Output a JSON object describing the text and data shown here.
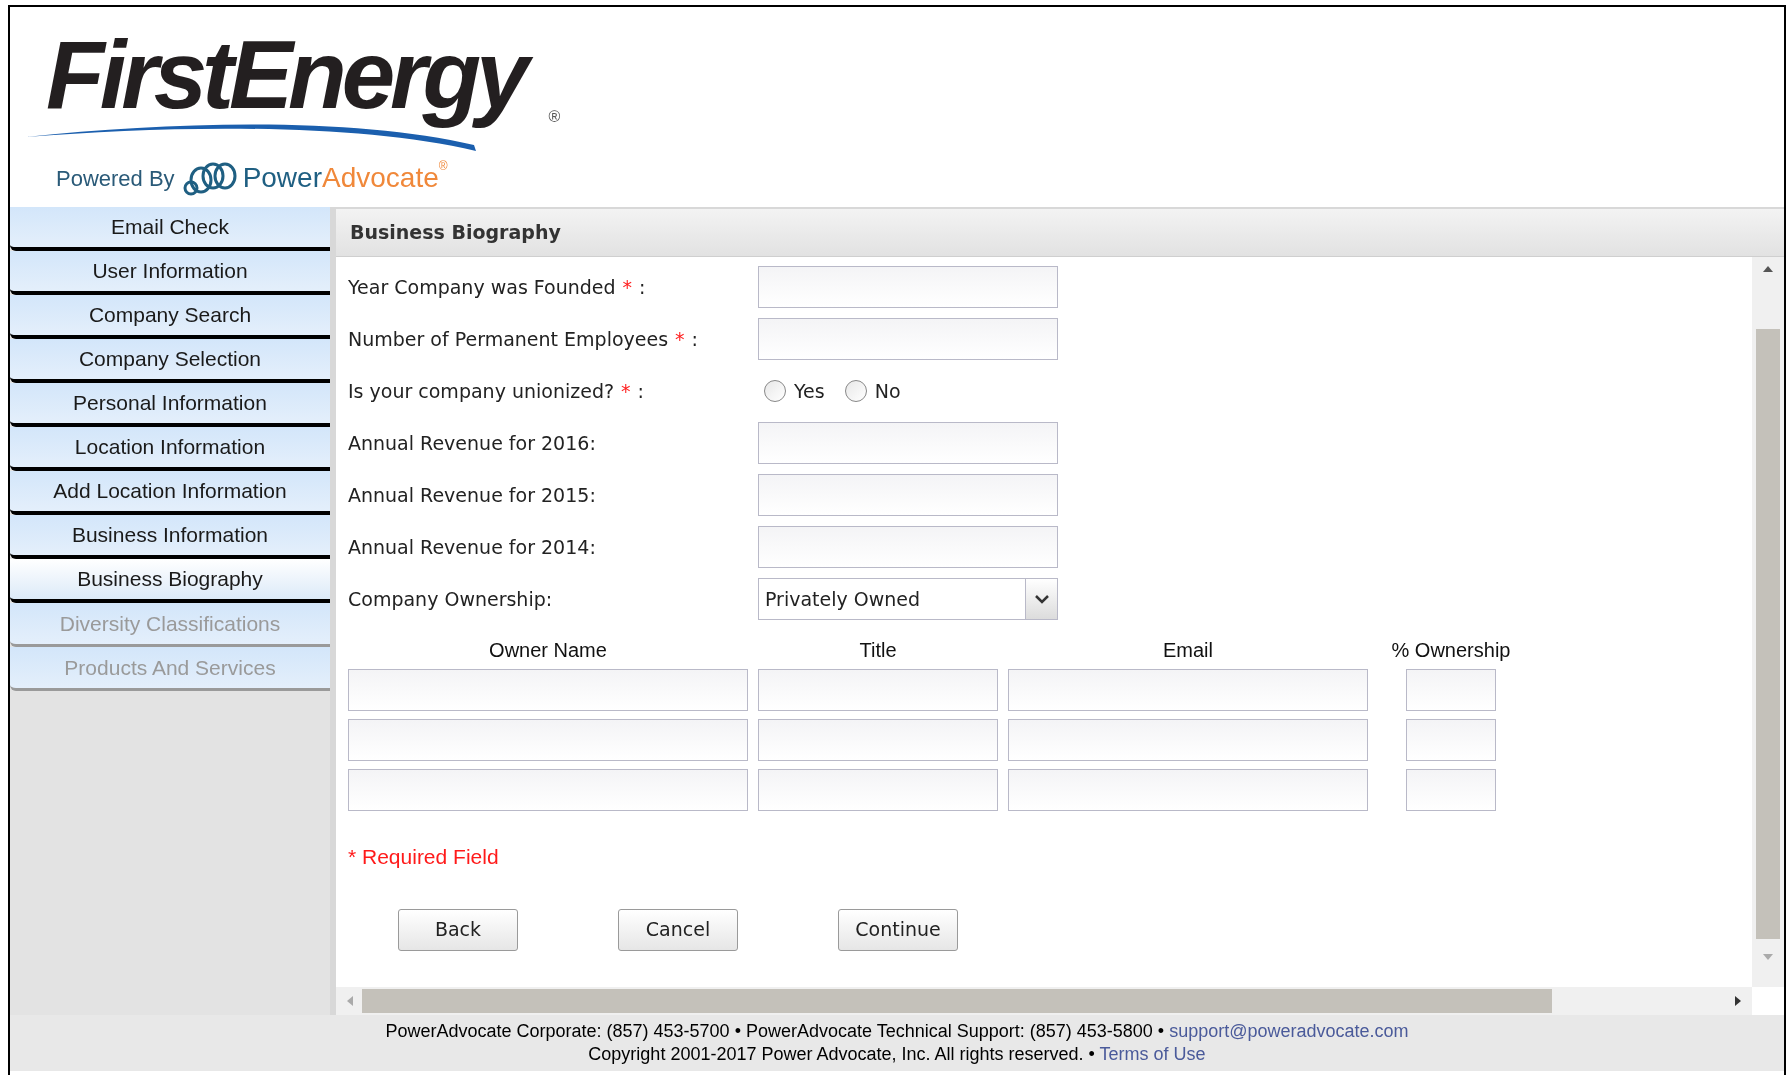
{
  "logo": {
    "name": "FirstEnergy",
    "registered": "®",
    "powered_by": "Powered By",
    "brand_first": "Power",
    "brand_second": "Advocate",
    "brand_registered": "®"
  },
  "sidebar": {
    "items": [
      {
        "label": "Email Check",
        "selected": false,
        "disabled": false
      },
      {
        "label": "User Information",
        "selected": false,
        "disabled": false
      },
      {
        "label": "Company Search",
        "selected": false,
        "disabled": false
      },
      {
        "label": "Company Selection",
        "selected": false,
        "disabled": false
      },
      {
        "label": "Personal Information",
        "selected": false,
        "disabled": false
      },
      {
        "label": "Location Information",
        "selected": false,
        "disabled": false
      },
      {
        "label": "Add Location Information",
        "selected": false,
        "disabled": false
      },
      {
        "label": "Business Information",
        "selected": false,
        "disabled": false
      },
      {
        "label": "Business Biography",
        "selected": true,
        "disabled": false
      },
      {
        "label": "Diversity Classifications",
        "selected": false,
        "disabled": true
      },
      {
        "label": "Products And Services",
        "selected": false,
        "disabled": true
      }
    ]
  },
  "panel": {
    "title": "Business Biography",
    "fields": [
      {
        "kind": "text",
        "label": "Year Company was Founded",
        "mark": "*",
        "suffix": ":"
      },
      {
        "kind": "text",
        "label": "Number of Permanent Employees",
        "mark": "*",
        "suffix": ":"
      },
      {
        "kind": "radio",
        "label": "Is your company unionized?",
        "mark": "*",
        "suffix": ":",
        "options": [
          {
            "label": "Yes",
            "checked": false
          },
          {
            "label": "No",
            "checked": false
          }
        ]
      },
      {
        "kind": "text",
        "label": "Annual Revenue for 2016:"
      },
      {
        "kind": "text",
        "label": "Annual Revenue for 2015:"
      },
      {
        "kind": "text",
        "label": "Annual Revenue for 2014:"
      },
      {
        "kind": "select",
        "label": "Company Ownership:",
        "value": "Privately Owned"
      }
    ],
    "owners": {
      "columns": [
        "Owner Name",
        "Title",
        "Email",
        "% Ownership"
      ],
      "rows": [
        {
          "kind": "blank"
        },
        {
          "kind": "blank"
        },
        {
          "kind": "blank"
        }
      ]
    },
    "required_note": "* Required Field",
    "buttons": [
      "Back",
      "Cancel",
      "Continue"
    ]
  },
  "footer": {
    "line_1": "PowerAdvocate Corporate: (857) 453-5700 • PowerAdvocate Technical Support: (857) 453-5800 •",
    "email_link": "support@poweradvocate.com",
    "line_2": "Copyright 2001-2017 Power Advocate, Inc. All rights reserved. •",
    "terms_link": "Terms of Use"
  }
}
